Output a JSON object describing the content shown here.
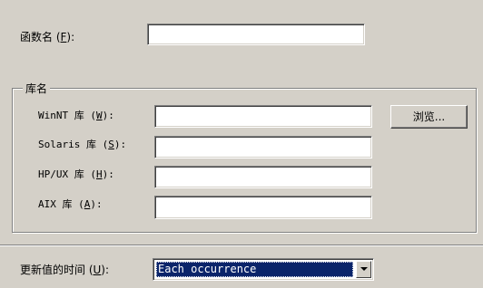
{
  "function_name": {
    "label_pre": "函数名 (",
    "mnemonic": "F",
    "label_post": "):",
    "value": ""
  },
  "library_group": {
    "title": "库名",
    "browse_label": "浏览...",
    "fields": [
      {
        "label_pre": "WinNT 库 (",
        "mnemonic": "W",
        "label_post": "):",
        "value": ""
      },
      {
        "label_pre": "Solaris 库 (",
        "mnemonic": "S",
        "label_post": "):",
        "value": ""
      },
      {
        "label_pre": "HP/UX 库 (",
        "mnemonic": "H",
        "label_post": "):",
        "value": ""
      },
      {
        "label_pre": "AIX 库 (",
        "mnemonic": "A",
        "label_post": "):",
        "value": ""
      }
    ]
  },
  "update_time": {
    "label_pre": "更新值的时间 (",
    "mnemonic": "U",
    "label_post": "):",
    "selected": "Each occurrence"
  }
}
